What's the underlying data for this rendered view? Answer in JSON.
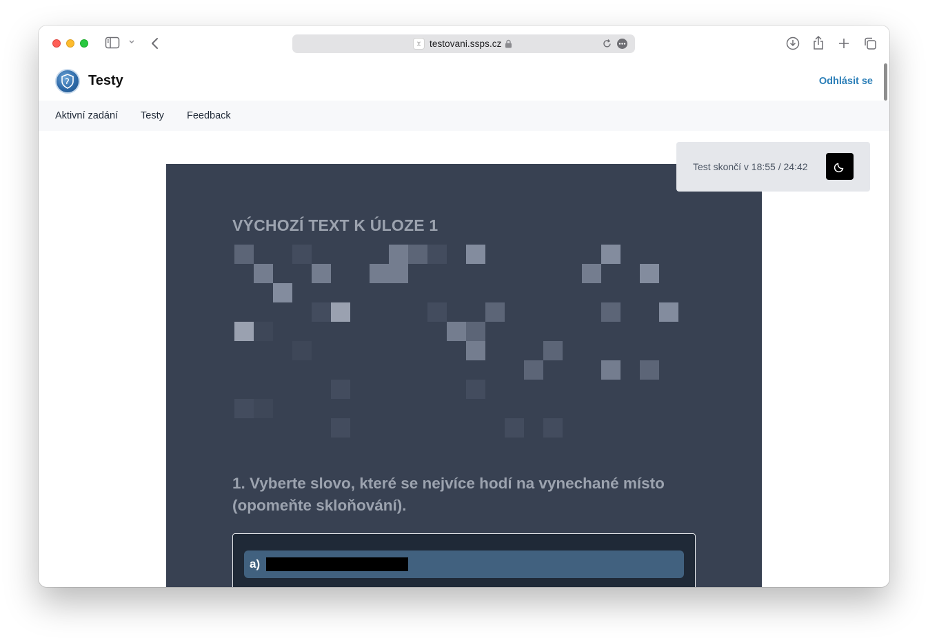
{
  "browser": {
    "url": "testovani.ssps.cz",
    "lock_icon": "lock-icon",
    "reload_icon": "reload-icon",
    "more_icon": "ellipsis-circle-icon"
  },
  "header": {
    "title": "Testy",
    "logout_label": "Odhlásit se",
    "logo_icon": "school-logo"
  },
  "nav": {
    "items": [
      {
        "label": "Aktivní zadání"
      },
      {
        "label": "Testy"
      },
      {
        "label": "Feedback"
      }
    ]
  },
  "timer": {
    "text": "Test skončí v 18:55 / 24:42",
    "theme_icon": "moon-icon"
  },
  "content": {
    "section_title": "VÝCHOZÍ TEXT K ÚLOZE 1",
    "question": "1. Vyberte slovo, které se nejvíce hodí na vynechané místo (opomeňte skloňování).",
    "options": [
      {
        "letter": "a)"
      }
    ]
  },
  "colors": {
    "panel_bg": "#384152",
    "option_bg": "#41617f",
    "link": "#2c7fb8",
    "nav_bg": "#f7f8fa"
  }
}
